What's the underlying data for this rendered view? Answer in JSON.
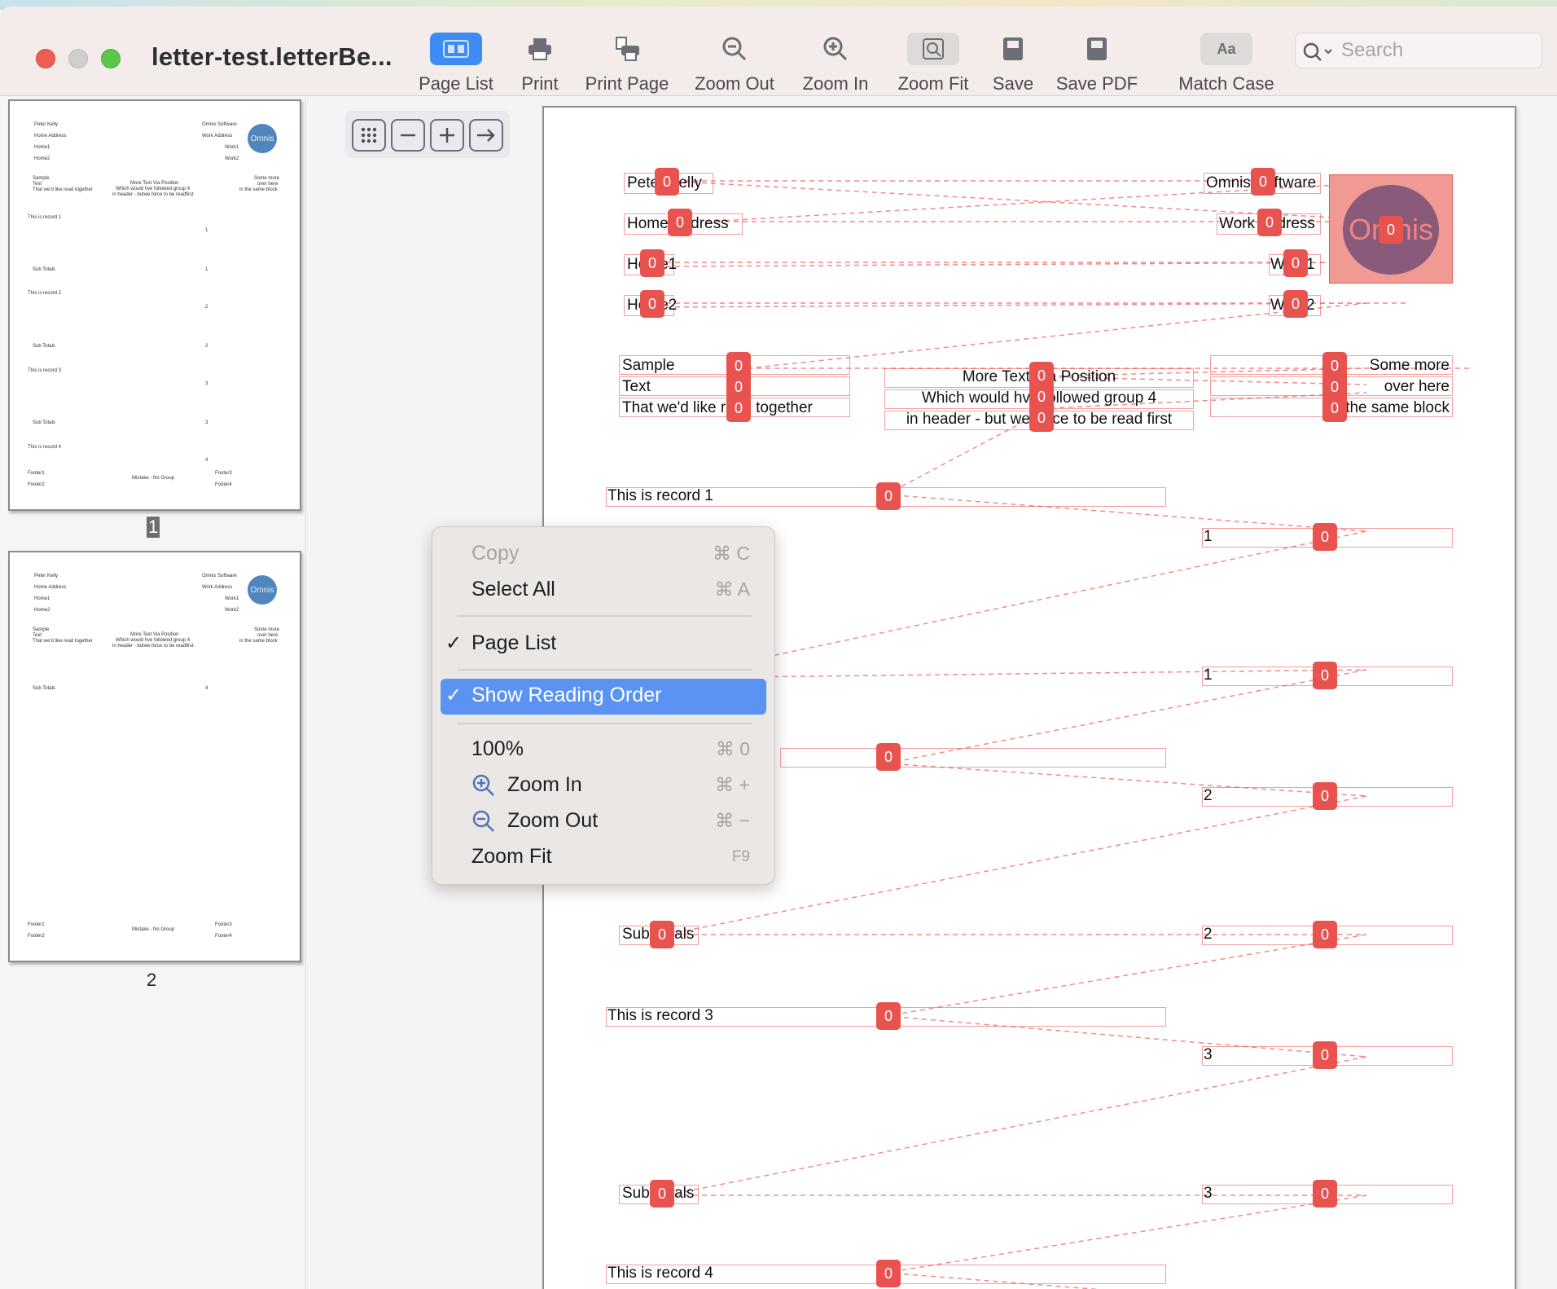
{
  "window": {
    "title": "letter-test.letterBe...",
    "traffic_lights": [
      "#ed5f55",
      "#d0cfce",
      "#5cc64b"
    ]
  },
  "toolbar": {
    "items": [
      {
        "label": "Page List",
        "icon": "page-list-icon"
      },
      {
        "label": "Print",
        "icon": "printer-icon"
      },
      {
        "label": "Print Page",
        "icon": "print-page-icon"
      },
      {
        "label": "Zoom Out",
        "icon": "zoom-out-icon"
      },
      {
        "label": "Zoom In",
        "icon": "zoom-in-icon"
      },
      {
        "label": "Zoom Fit",
        "icon": "zoom-fit-icon"
      },
      {
        "label": "Save",
        "icon": "save-icon"
      },
      {
        "label": "Save PDF",
        "icon": "save-pdf-icon"
      },
      {
        "label": "Match Case",
        "icon": "match-case-icon",
        "icon_text": "Aa"
      }
    ],
    "search_placeholder": "Search"
  },
  "sidebar": {
    "pages": [
      {
        "number": "1",
        "lines": {
          "left": [
            "Peter Kelly",
            "Home Address",
            "Home1",
            "Home2"
          ],
          "right": [
            "Omnis Software",
            "Work Address",
            "Work1",
            "Work2"
          ],
          "logo": "Omnis",
          "block_left": [
            "Sample",
            "Text",
            "That we'd like read together"
          ],
          "block_mid": [
            "More Text Via Position",
            "Which would hve followed group 4",
            "in header - butwe force to be readfirst"
          ],
          "block_right": [
            "Some more",
            "over here",
            "in the same block"
          ],
          "records": [
            {
              "text": "This is record 1",
              "value": "1",
              "subtotal_label": "Sub Totals",
              "subtotal": "1"
            },
            {
              "text": "This is record 2",
              "value": "2",
              "subtotal_label": "Sub Totals",
              "subtotal": "2"
            },
            {
              "text": "This is record 3",
              "value": "3",
              "subtotal_label": "Sub Totals",
              "subtotal": "3"
            },
            {
              "text": "This is record 4",
              "value": "4"
            }
          ],
          "footer": [
            "Footer1",
            "Footer2",
            "Mistake - No Group",
            "Footer3",
            "Footer4"
          ]
        }
      },
      {
        "number": "2",
        "lines": {
          "subtotal_label": "Sub Totals",
          "subtotal": "4",
          "footer": [
            "Footer1",
            "Footer2",
            "Mistake - No Group",
            "Footer3",
            "Footer4"
          ]
        }
      }
    ]
  },
  "zoom_controls": {
    "icons": [
      "grid-icon",
      "minus-icon",
      "plus-icon",
      "arrow-right-icon"
    ]
  },
  "document": {
    "reading_order_index": "0",
    "logo_text": "Omnis",
    "fields": [
      "Peter Kelly",
      "Home Address",
      "Home1",
      "Home2",
      "Omnis Software",
      "Work Address",
      "Work1",
      "Work2",
      "Sample",
      "Text",
      "That we'd like read together",
      "More Text Via Position",
      "Which would hve followed group 4",
      "in header - but we force to be read first",
      "Some more",
      "over here",
      "in the same block",
      "This is record 1",
      "1",
      "1",
      "2",
      "2",
      "Sub Totals",
      "2",
      "This is record 3",
      "3",
      "Sub Totals",
      "3",
      "This is record 4"
    ]
  },
  "context_menu": {
    "copy": {
      "label": "Copy",
      "shortcut": "⌘ C"
    },
    "select_all": {
      "label": "Select All",
      "shortcut": "⌘ A"
    },
    "page_list": {
      "label": "Page List",
      "check": "✓"
    },
    "show_reading_order": {
      "label": "Show Reading Order",
      "check": "✓"
    },
    "zoom_100": {
      "label": "100%",
      "shortcut": "⌘ 0"
    },
    "zoom_in": {
      "label": "Zoom In",
      "shortcut": "⌘ +"
    },
    "zoom_out": {
      "label": "Zoom Out",
      "shortcut": "⌘ −"
    },
    "zoom_fit": {
      "label": "Zoom Fit",
      "shortcut": "F9"
    },
    "highlight_color": "#5b93f2"
  }
}
